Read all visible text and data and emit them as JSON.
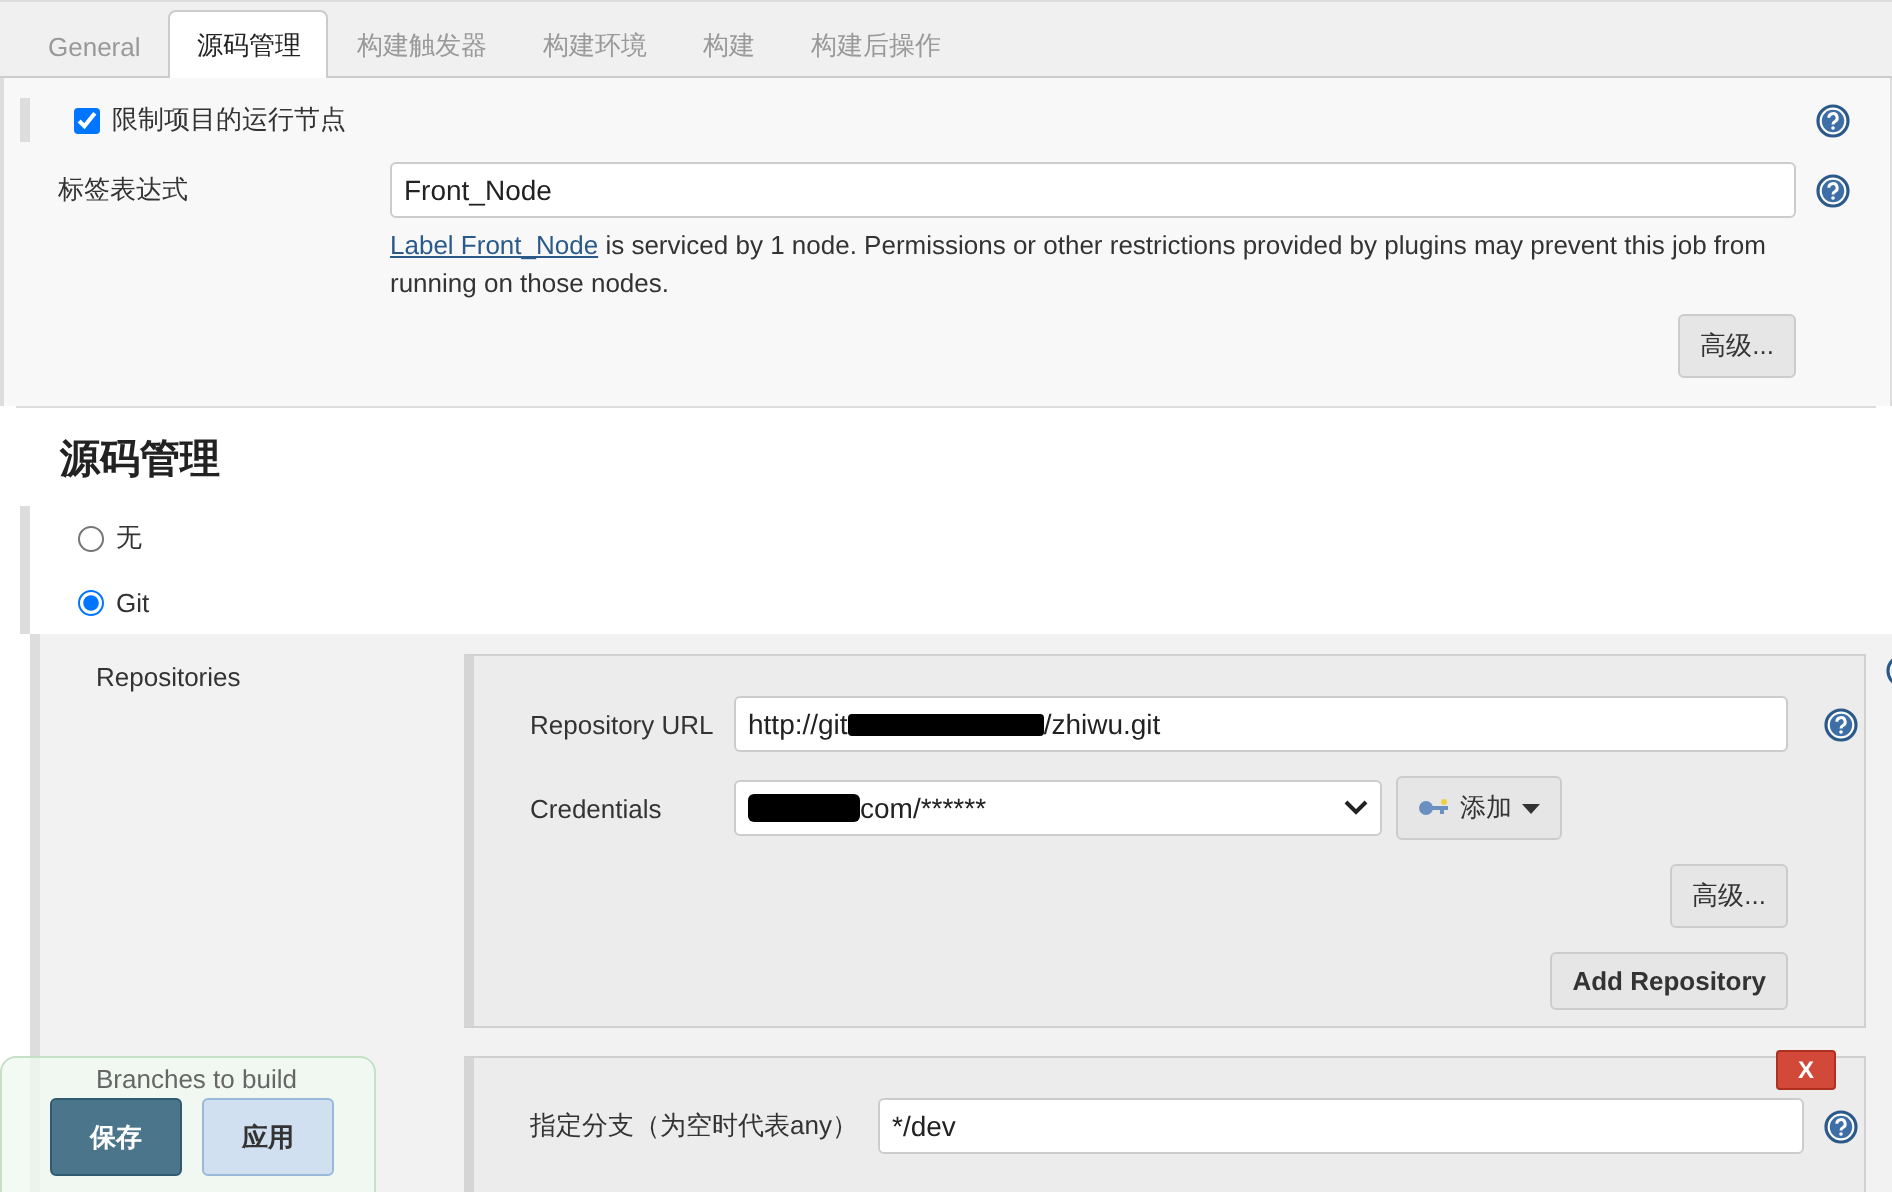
{
  "tabs": [
    {
      "label": "General",
      "selected": false
    },
    {
      "label": "源码管理",
      "selected": true
    },
    {
      "label": "构建触发器",
      "selected": false
    },
    {
      "label": "构建环境",
      "selected": false
    },
    {
      "label": "构建",
      "selected": false
    },
    {
      "label": "构建后操作",
      "selected": false
    }
  ],
  "restrict": {
    "label": "限制项目的运行节点",
    "checked": true
  },
  "label_expression": {
    "label": "标签表达式",
    "value": "Front_Node",
    "link": "Label Front_Node",
    "note": "is serviced by 1 node. Permissions or other restrictions provided by plugins may prevent this job from running on those nodes.",
    "advanced": "高级..."
  },
  "scm": {
    "heading": "源码管理",
    "options": [
      {
        "label": "无",
        "selected": false
      },
      {
        "label": "Git",
        "selected": true
      }
    ]
  },
  "repositories": {
    "label": "Repositories",
    "url_label": "Repository URL",
    "url_prefix": "http://git",
    "url_suffix": "/zhiwu.git",
    "credentials_label": "Credentials",
    "credentials_value": "com/******",
    "add": "添加",
    "advanced": "高级...",
    "add_repository": "Add Repository"
  },
  "branches": {
    "label": "Branches to build",
    "delete": "X",
    "branch_label": "指定分支（为空时代表any）",
    "branch_value": "*/dev"
  },
  "footer": {
    "save": "保存",
    "apply": "应用"
  }
}
